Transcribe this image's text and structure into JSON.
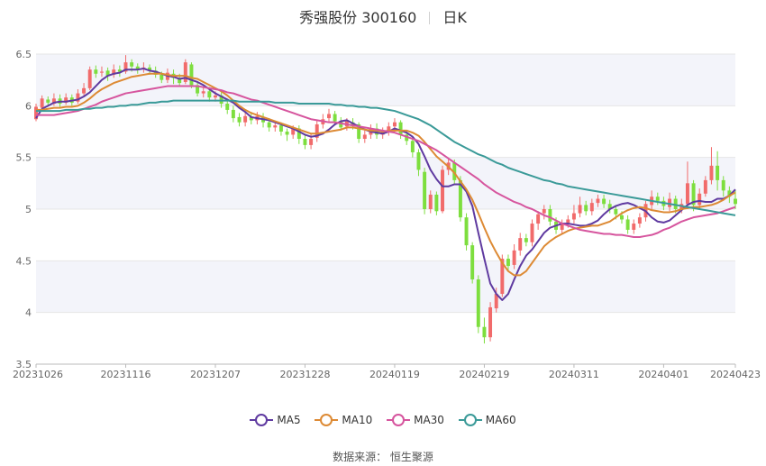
{
  "title": {
    "stock": "秀强股份 300160",
    "period": "日K"
  },
  "source_label": "数据来源：  恒生聚源",
  "colors": {
    "up": "#f16b6b",
    "down": "#7dde3e",
    "ma5": "#5f3aa0",
    "ma10": "#dd8a34",
    "ma30": "#d6559e",
    "ma60": "#3a9a98",
    "grid_band": "#f3f4fa"
  },
  "chart_data": {
    "type": "candlestick",
    "ylim": [
      3.5,
      6.5
    ],
    "yticks": [
      "3.5",
      "4",
      "4.5",
      "5",
      "5.5",
      "6",
      "6.5"
    ],
    "xticks": [
      "20231026",
      "20231116",
      "20231207",
      "20231228",
      "20240119",
      "20240219",
      "20240311",
      "20240401",
      "20240423"
    ],
    "n_days": 118,
    "xtick_index": [
      0,
      15,
      30,
      45,
      60,
      75,
      90,
      105,
      117
    ],
    "candles": [
      [
        5.87,
        5.99,
        5.85,
        6.02
      ],
      [
        5.98,
        6.07,
        5.95,
        6.1
      ],
      [
        6.06,
        6.03,
        5.99,
        6.09
      ],
      [
        6.02,
        6.07,
        6.0,
        6.12
      ],
      [
        6.07,
        6.02,
        5.99,
        6.11
      ],
      [
        6.03,
        6.08,
        6.01,
        6.12
      ],
      [
        6.08,
        6.03,
        6.0,
        6.11
      ],
      [
        6.04,
        6.12,
        6.02,
        6.16
      ],
      [
        6.12,
        6.17,
        6.1,
        6.22
      ],
      [
        6.17,
        6.35,
        6.15,
        6.38
      ],
      [
        6.35,
        6.31,
        6.27,
        6.39
      ],
      [
        6.32,
        6.33,
        6.28,
        6.38
      ],
      [
        6.34,
        6.29,
        6.24,
        6.37
      ],
      [
        6.3,
        6.35,
        6.27,
        6.4
      ],
      [
        6.35,
        6.33,
        6.28,
        6.39
      ],
      [
        6.33,
        6.42,
        6.31,
        6.49
      ],
      [
        6.42,
        6.38,
        6.33,
        6.45
      ],
      [
        6.38,
        6.35,
        6.31,
        6.41
      ],
      [
        6.36,
        6.37,
        6.32,
        6.42
      ],
      [
        6.37,
        6.34,
        6.3,
        6.4
      ],
      [
        6.34,
        6.3,
        6.27,
        6.38
      ],
      [
        6.3,
        6.25,
        6.22,
        6.33
      ],
      [
        6.25,
        6.32,
        6.22,
        6.36
      ],
      [
        6.31,
        6.27,
        6.21,
        6.35
      ],
      [
        6.27,
        6.22,
        6.19,
        6.31
      ],
      [
        6.23,
        6.42,
        6.21,
        6.45
      ],
      [
        6.4,
        6.2,
        6.17,
        6.42
      ],
      [
        6.2,
        6.12,
        6.09,
        6.24
      ],
      [
        6.12,
        6.14,
        6.08,
        6.18
      ],
      [
        6.14,
        6.08,
        6.04,
        6.18
      ],
      [
        6.08,
        6.1,
        6.04,
        6.14
      ],
      [
        6.1,
        6.02,
        5.98,
        6.13
      ],
      [
        6.02,
        5.96,
        5.92,
        6.05
      ],
      [
        5.96,
        5.88,
        5.84,
        6.0
      ],
      [
        5.89,
        5.84,
        5.8,
        5.93
      ],
      [
        5.84,
        5.9,
        5.8,
        5.94
      ],
      [
        5.89,
        5.86,
        5.82,
        5.94
      ],
      [
        5.86,
        5.9,
        5.82,
        5.94
      ],
      [
        5.89,
        5.84,
        5.79,
        5.93
      ],
      [
        5.84,
        5.79,
        5.75,
        5.88
      ],
      [
        5.79,
        5.81,
        5.75,
        5.85
      ],
      [
        5.81,
        5.75,
        5.71,
        5.84
      ],
      [
        5.75,
        5.72,
        5.66,
        5.78
      ],
      [
        5.72,
        5.78,
        5.68,
        5.81
      ],
      [
        5.78,
        5.68,
        5.63,
        5.81
      ],
      [
        5.68,
        5.62,
        5.58,
        5.72
      ],
      [
        5.62,
        5.68,
        5.58,
        5.73
      ],
      [
        5.69,
        5.82,
        5.65,
        5.86
      ],
      [
        5.82,
        5.87,
        5.78,
        5.92
      ],
      [
        5.88,
        5.92,
        5.84,
        5.97
      ],
      [
        5.92,
        5.85,
        5.81,
        5.95
      ],
      [
        5.85,
        5.79,
        5.76,
        5.89
      ],
      [
        5.8,
        5.85,
        5.76,
        5.88
      ],
      [
        5.84,
        5.81,
        5.77,
        5.88
      ],
      [
        5.82,
        5.68,
        5.64,
        5.84
      ],
      [
        5.68,
        5.72,
        5.64,
        5.76
      ],
      [
        5.72,
        5.78,
        5.68,
        5.82
      ],
      [
        5.78,
        5.72,
        5.68,
        5.83
      ],
      [
        5.72,
        5.75,
        5.68,
        5.79
      ],
      [
        5.75,
        5.8,
        5.71,
        5.84
      ],
      [
        5.8,
        5.84,
        5.75,
        5.88
      ],
      [
        5.84,
        5.72,
        5.68,
        5.86
      ],
      [
        5.72,
        5.66,
        5.62,
        5.75
      ],
      [
        5.66,
        5.55,
        5.5,
        5.69
      ],
      [
        5.55,
        5.38,
        5.32,
        5.58
      ],
      [
        5.36,
        5.0,
        4.95,
        5.4
      ],
      [
        5.0,
        5.14,
        4.96,
        5.18
      ],
      [
        5.14,
        4.98,
        4.94,
        5.17
      ],
      [
        4.98,
        5.38,
        4.96,
        5.42
      ],
      [
        5.38,
        5.45,
        5.33,
        5.49
      ],
      [
        5.45,
        5.28,
        5.24,
        5.48
      ],
      [
        5.28,
        4.92,
        4.88,
        5.32
      ],
      [
        4.92,
        4.65,
        4.6,
        4.96
      ],
      [
        4.65,
        4.32,
        4.28,
        4.68
      ],
      [
        4.32,
        3.86,
        3.8,
        4.36
      ],
      [
        3.86,
        3.76,
        3.7,
        3.95
      ],
      [
        3.76,
        4.05,
        3.72,
        4.1
      ],
      [
        4.04,
        4.18,
        4.0,
        4.24
      ],
      [
        4.18,
        4.52,
        4.15,
        4.56
      ],
      [
        4.52,
        4.45,
        4.41,
        4.56
      ],
      [
        4.46,
        4.6,
        4.42,
        4.66
      ],
      [
        4.6,
        4.72,
        4.55,
        4.77
      ],
      [
        4.72,
        4.68,
        4.64,
        4.76
      ],
      [
        4.68,
        4.86,
        4.64,
        4.9
      ],
      [
        4.86,
        4.95,
        4.8,
        4.98
      ],
      [
        4.96,
        5.0,
        4.9,
        5.04
      ],
      [
        5.0,
        4.88,
        4.84,
        5.04
      ],
      [
        4.88,
        4.8,
        4.76,
        4.92
      ],
      [
        4.8,
        4.86,
        4.76,
        4.9
      ],
      [
        4.86,
        4.9,
        4.82,
        4.94
      ],
      [
        4.9,
        4.96,
        4.86,
        5.04
      ],
      [
        4.96,
        5.04,
        4.92,
        5.12
      ],
      [
        5.04,
        4.98,
        4.94,
        5.08
      ],
      [
        4.98,
        5.06,
        4.94,
        5.1
      ],
      [
        5.06,
        5.1,
        5.02,
        5.14
      ],
      [
        5.1,
        5.05,
        5.01,
        5.14
      ],
      [
        5.05,
        5.0,
        4.96,
        5.09
      ],
      [
        5.0,
        4.95,
        4.9,
        5.04
      ],
      [
        4.94,
        4.9,
        4.86,
        4.98
      ],
      [
        4.9,
        4.8,
        4.76,
        4.94
      ],
      [
        4.8,
        4.86,
        4.76,
        4.9
      ],
      [
        4.86,
        4.92,
        4.82,
        4.96
      ],
      [
        4.92,
        5.05,
        4.88,
        5.08
      ],
      [
        5.04,
        5.12,
        5.0,
        5.18
      ],
      [
        5.12,
        5.08,
        5.04,
        5.16
      ],
      [
        5.08,
        5.03,
        4.99,
        5.12
      ],
      [
        5.02,
        5.1,
        4.98,
        5.16
      ],
      [
        5.1,
        5.0,
        4.96,
        5.13
      ],
      [
        5.0,
        5.05,
        4.96,
        5.1
      ],
      [
        5.05,
        5.25,
        5.0,
        5.46
      ],
      [
        5.25,
        5.04,
        4.98,
        5.28
      ],
      [
        5.04,
        5.15,
        5.0,
        5.2
      ],
      [
        5.15,
        5.28,
        5.12,
        5.32
      ],
      [
        5.28,
        5.42,
        5.24,
        5.6
      ],
      [
        5.42,
        5.28,
        5.18,
        5.56
      ],
      [
        5.28,
        5.18,
        5.12,
        5.32
      ],
      [
        5.18,
        5.12,
        5.06,
        5.22
      ],
      [
        5.1,
        5.05,
        5.0,
        5.18
      ]
    ],
    "series": [
      {
        "name": "MA5",
        "values": [
          5.88,
          5.97,
          6.0,
          6.03,
          6.04,
          6.04,
          6.05,
          6.06,
          6.09,
          6.13,
          6.19,
          6.25,
          6.29,
          6.31,
          6.32,
          6.35,
          6.35,
          6.35,
          6.36,
          6.34,
          6.33,
          6.31,
          6.29,
          6.28,
          6.26,
          6.27,
          6.25,
          6.23,
          6.2,
          6.16,
          6.12,
          6.09,
          6.06,
          6.03,
          5.98,
          5.94,
          5.89,
          5.88,
          5.87,
          5.86,
          5.84,
          5.82,
          5.8,
          5.78,
          5.75,
          5.72,
          5.7,
          5.71,
          5.73,
          5.77,
          5.82,
          5.85,
          5.86,
          5.83,
          5.8,
          5.77,
          5.75,
          5.74,
          5.73,
          5.75,
          5.78,
          5.76,
          5.74,
          5.7,
          5.63,
          5.51,
          5.38,
          5.29,
          5.22,
          5.22,
          5.24,
          5.24,
          5.17,
          5.03,
          4.77,
          4.52,
          4.28,
          4.18,
          4.12,
          4.18,
          4.32,
          4.45,
          4.55,
          4.61,
          4.69,
          4.77,
          4.82,
          4.84,
          4.86,
          4.86,
          4.85,
          4.84,
          4.84,
          4.86,
          4.89,
          4.95,
          5.0,
          5.03,
          5.05,
          5.06,
          5.04,
          5.01,
          4.98,
          4.92,
          4.88,
          4.87,
          4.89,
          4.94,
          4.99,
          5.04,
          5.07,
          5.08,
          5.07,
          5.07,
          5.1,
          5.1,
          5.13,
          5.19
        ]
      },
      {
        "name": "MA10",
        "values": [
          5.96,
          5.96,
          5.97,
          5.98,
          5.98,
          5.99,
          5.99,
          6.0,
          6.03,
          6.07,
          6.12,
          6.16,
          6.19,
          6.22,
          6.24,
          6.26,
          6.28,
          6.29,
          6.3,
          6.31,
          6.31,
          6.31,
          6.3,
          6.29,
          6.29,
          6.29,
          6.27,
          6.26,
          6.23,
          6.2,
          6.17,
          6.14,
          6.1,
          6.05,
          6.0,
          5.96,
          5.93,
          5.91,
          5.89,
          5.87,
          5.85,
          5.83,
          5.81,
          5.79,
          5.77,
          5.75,
          5.73,
          5.73,
          5.74,
          5.75,
          5.76,
          5.77,
          5.79,
          5.79,
          5.78,
          5.77,
          5.76,
          5.76,
          5.75,
          5.76,
          5.76,
          5.76,
          5.76,
          5.74,
          5.71,
          5.65,
          5.58,
          5.51,
          5.46,
          5.41,
          5.35,
          5.27,
          5.19,
          5.09,
          4.96,
          4.82,
          4.69,
          4.58,
          4.48,
          4.4,
          4.36,
          4.36,
          4.4,
          4.48,
          4.56,
          4.64,
          4.69,
          4.73,
          4.76,
          4.79,
          4.81,
          4.82,
          4.83,
          4.84,
          4.84,
          4.86,
          4.88,
          4.92,
          4.96,
          4.99,
          5.01,
          5.02,
          5.01,
          4.99,
          4.98,
          4.97,
          4.97,
          4.98,
          5.0,
          5.01,
          5.02,
          5.02,
          5.03,
          5.04,
          5.06,
          5.09,
          5.13,
          5.16
        ]
      },
      {
        "name": "MA30",
        "values": [
          5.91,
          5.91,
          5.91,
          5.91,
          5.92,
          5.93,
          5.94,
          5.95,
          5.97,
          5.99,
          6.01,
          6.04,
          6.06,
          6.08,
          6.1,
          6.12,
          6.13,
          6.14,
          6.15,
          6.16,
          6.17,
          6.18,
          6.19,
          6.19,
          6.19,
          6.19,
          6.19,
          6.19,
          6.18,
          6.17,
          6.16,
          6.15,
          6.13,
          6.12,
          6.1,
          6.08,
          6.06,
          6.05,
          6.03,
          6.01,
          5.99,
          5.97,
          5.95,
          5.93,
          5.91,
          5.89,
          5.87,
          5.86,
          5.85,
          5.84,
          5.84,
          5.83,
          5.82,
          5.81,
          5.8,
          5.79,
          5.78,
          5.77,
          5.76,
          5.75,
          5.74,
          5.72,
          5.7,
          5.68,
          5.66,
          5.63,
          5.6,
          5.57,
          5.53,
          5.49,
          5.45,
          5.41,
          5.37,
          5.33,
          5.29,
          5.24,
          5.2,
          5.16,
          5.13,
          5.1,
          5.07,
          5.05,
          5.02,
          5.0,
          4.97,
          4.94,
          4.92,
          4.89,
          4.86,
          4.84,
          4.82,
          4.8,
          4.79,
          4.78,
          4.77,
          4.76,
          4.76,
          4.75,
          4.75,
          4.74,
          4.73,
          4.73,
          4.74,
          4.75,
          4.77,
          4.8,
          4.82,
          4.85,
          4.88,
          4.9,
          4.92,
          4.93,
          4.94,
          4.95,
          4.96,
          4.98,
          5.0,
          5.02
        ]
      },
      {
        "name": "MA60",
        "values": [
          5.95,
          5.95,
          5.95,
          5.95,
          5.95,
          5.96,
          5.96,
          5.96,
          5.97,
          5.97,
          5.98,
          5.98,
          5.99,
          5.99,
          6.0,
          6.0,
          6.01,
          6.01,
          6.02,
          6.03,
          6.03,
          6.04,
          6.04,
          6.05,
          6.05,
          6.05,
          6.05,
          6.05,
          6.05,
          6.05,
          6.05,
          6.05,
          6.05,
          6.05,
          6.04,
          6.04,
          6.04,
          6.04,
          6.04,
          6.04,
          6.03,
          6.03,
          6.03,
          6.03,
          6.02,
          6.02,
          6.02,
          6.02,
          6.02,
          6.02,
          6.01,
          6.01,
          6.0,
          6.0,
          5.99,
          5.99,
          5.98,
          5.98,
          5.97,
          5.96,
          5.95,
          5.93,
          5.91,
          5.89,
          5.87,
          5.84,
          5.81,
          5.77,
          5.73,
          5.69,
          5.65,
          5.62,
          5.59,
          5.56,
          5.53,
          5.51,
          5.48,
          5.45,
          5.43,
          5.4,
          5.38,
          5.36,
          5.34,
          5.32,
          5.3,
          5.28,
          5.27,
          5.25,
          5.24,
          5.22,
          5.21,
          5.2,
          5.19,
          5.18,
          5.17,
          5.16,
          5.15,
          5.14,
          5.13,
          5.12,
          5.11,
          5.1,
          5.09,
          5.08,
          5.07,
          5.06,
          5.05,
          5.04,
          5.03,
          5.02,
          5.01,
          5.0,
          4.99,
          4.98,
          4.97,
          4.96,
          4.95,
          4.94
        ]
      }
    ]
  }
}
